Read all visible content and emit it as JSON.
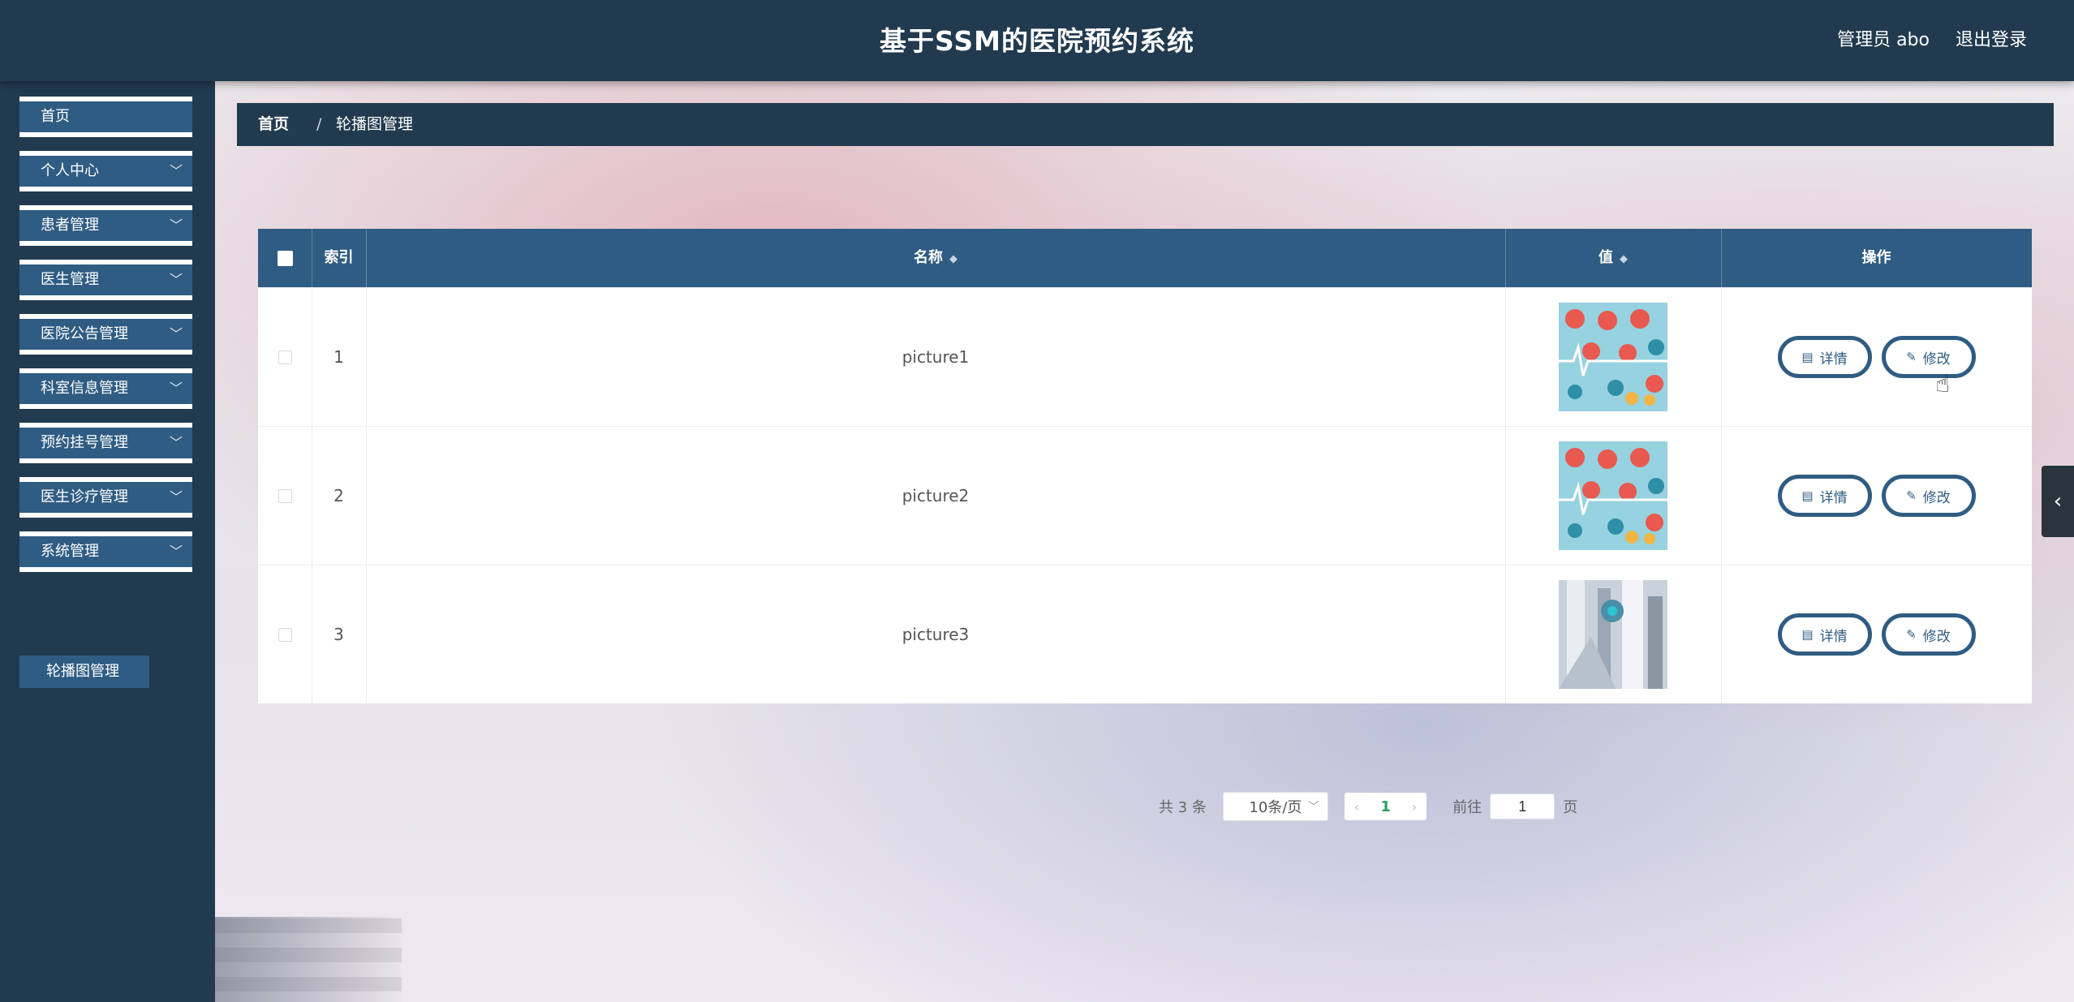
{
  "header": {
    "title": "基于SSM的医院预约系统",
    "user_label": "管理员 abo",
    "logout_label": "退出登录"
  },
  "sidebar": {
    "items": [
      {
        "label": "首页",
        "has_submenu": false
      },
      {
        "label": "个人中心",
        "has_submenu": true
      },
      {
        "label": "患者管理",
        "has_submenu": true
      },
      {
        "label": "医生管理",
        "has_submenu": true
      },
      {
        "label": "医院公告管理",
        "has_submenu": true
      },
      {
        "label": "科室信息管理",
        "has_submenu": true
      },
      {
        "label": "预约挂号管理",
        "has_submenu": true
      },
      {
        "label": "医生诊疗管理",
        "has_submenu": true
      },
      {
        "label": "系统管理",
        "has_submenu": true
      }
    ],
    "active_subitem": "轮播图管理",
    "chevron_icon": "chevron-down-icon"
  },
  "breadcrumb": {
    "home": "首页",
    "separator": "/",
    "current": "轮播图管理"
  },
  "table": {
    "columns": [
      "索引",
      "名称",
      "值",
      "操作"
    ],
    "rows": [
      {
        "index": "1",
        "name": "picture1",
        "image": "medical-ecg-pattern"
      },
      {
        "index": "2",
        "name": "picture2",
        "image": "medical-ecg-pattern"
      },
      {
        "index": "3",
        "name": "picture3",
        "image": "medical-equipment-photo"
      }
    ],
    "detail_label": "详情",
    "edit_label": "修改"
  },
  "pagination": {
    "total_text": "共 3 条",
    "page_size": "10条/页",
    "current_page": "1",
    "goto_label": "前往",
    "goto_value": "1",
    "page_suffix": "页"
  },
  "colors": {
    "header_bg": "#213a4f",
    "accent": "#2f5c83",
    "active_page": "#2aa05c"
  }
}
